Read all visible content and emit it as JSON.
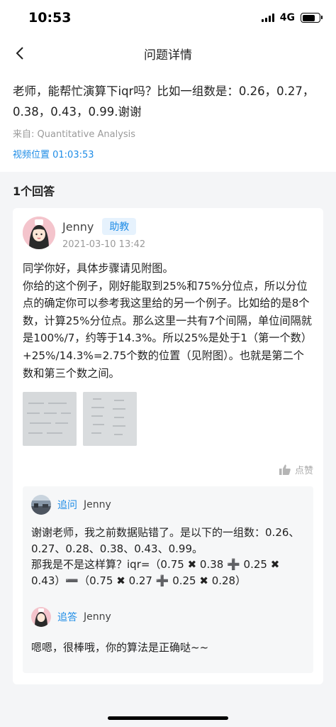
{
  "status_bar": {
    "time": "10:53",
    "network": "4G"
  },
  "nav": {
    "title": "问题详情"
  },
  "question": {
    "text": "老师，能帮忙演算下iqr吗？比如一组数是：0.26，0.27，0.38，0.43，0.99.谢谢",
    "source": "来自: Quantitative Analysis",
    "video_position": "视频位置 01:03:53"
  },
  "answers": {
    "count_label": "1个回答",
    "items": [
      {
        "author": "Jenny",
        "badge": "助教",
        "date": "2021-03-10 13:42",
        "text": "同学你好，具体步骤请见附图。\n你给的这个例子，刚好能取到25%和75%分位点，所以分位点的确定你可以参考我这里给的另一个例子。比如给的是8个数，计算25%分位点。那么这里一共有7个间隔，单位间隔就是100%/7，约等于14.3%。所以25%是处于1（第一个数）+25%/14.3%=2.75个数的位置（见附图）。也就是第二个数和第三个数之间。",
        "like_label": "点赞",
        "thread": [
          {
            "kind": "追问",
            "who": "Jenny",
            "text": "谢谢老师，我之前数据贴错了。是以下的一组数：0.26、0.27、0.28、0.38、0.43、0.99。\n那我是不是这样算？iqr=（0.75 ✖ 0.38 ➕ 0.25 ✖ 0.43）➖（0.75 ✖ 0.27 ➕ 0.25 ✖ 0.28）"
          },
          {
            "kind": "追答",
            "who": "Jenny",
            "text": "嗯嗯，很棒哦，你的算法是正确哒~~"
          }
        ]
      }
    ]
  },
  "icons": {
    "back": "chevron-left-icon",
    "like": "thumbs-up-icon",
    "signal": "cellular-signal-icon",
    "battery": "battery-icon"
  },
  "colors": {
    "accent": "#1e8ce6",
    "background": "#f4f5f7",
    "badge_bg": "#e6f2fd"
  }
}
